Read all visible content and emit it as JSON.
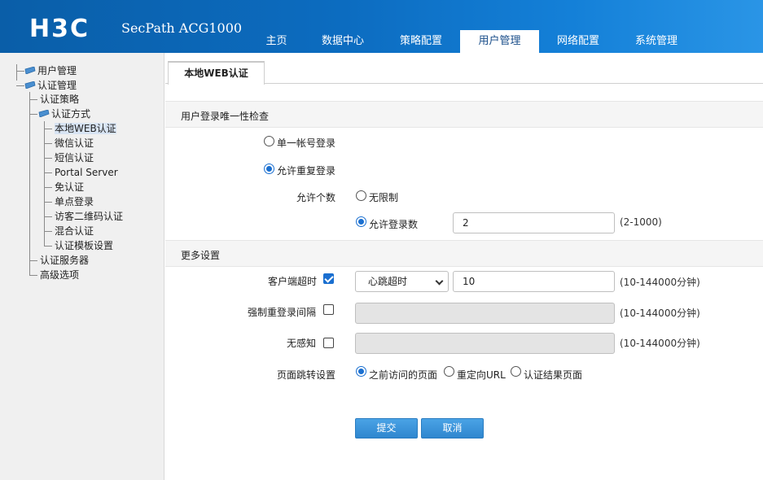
{
  "header": {
    "logo": "H3C",
    "product": "SecPath ACG1000",
    "nav": [
      {
        "label": "主页",
        "active": false
      },
      {
        "label": "数据中心",
        "active": false
      },
      {
        "label": "策略配置",
        "active": false
      },
      {
        "label": "用户管理",
        "active": true
      },
      {
        "label": "网络配置",
        "active": false
      },
      {
        "label": "系统管理",
        "active": false
      }
    ]
  },
  "sidebar": {
    "items": [
      {
        "label": "用户管理",
        "icon": "folder-icon"
      },
      {
        "label": "认证管理",
        "icon": "folder-icon"
      },
      {
        "label": "认证策略"
      },
      {
        "label": "认证方式",
        "icon": "folder-icon"
      },
      {
        "label": "本地WEB认证",
        "selected": true
      },
      {
        "label": "微信认证"
      },
      {
        "label": "短信认证"
      },
      {
        "label": "Portal Server"
      },
      {
        "label": "免认证"
      },
      {
        "label": "单点登录"
      },
      {
        "label": "访客二维码认证"
      },
      {
        "label": "混合认证"
      },
      {
        "label": "认证模板设置"
      },
      {
        "label": "认证服务器"
      },
      {
        "label": "高级选项"
      }
    ]
  },
  "main": {
    "tab": "本地WEB认证",
    "section1": {
      "title": "用户登录唯一性检查",
      "single_account": "单一帐号登录",
      "allow_repeat": "允许重复登录",
      "allow_count_label": "允许个数",
      "unlimited": "无限制",
      "allow_login_count": "允许登录数",
      "login_count_value": "2",
      "login_count_hint": "(2-1000)"
    },
    "section2": {
      "title": "更多设置",
      "client_timeout_label": "客户端超时",
      "timeout_type": "心跳超时",
      "timeout_value": "10",
      "timeout_hint": "(10-144000分钟)",
      "force_relogin_label": "强制重登录间隔",
      "force_relogin_hint": "(10-144000分钟)",
      "seamless_label": "无感知",
      "seamless_hint": "(10-144000分钟)",
      "redirect_label": "页面跳转设置",
      "redirect_prev": "之前访问的页面",
      "redirect_url": "重定向URL",
      "redirect_result": "认证结果页面"
    },
    "buttons": {
      "submit": "提交",
      "cancel": "取消"
    }
  },
  "colors": {
    "header_blue": "#0c6cc0",
    "accent": "#1a6fd0",
    "button": "#3a92d8"
  }
}
